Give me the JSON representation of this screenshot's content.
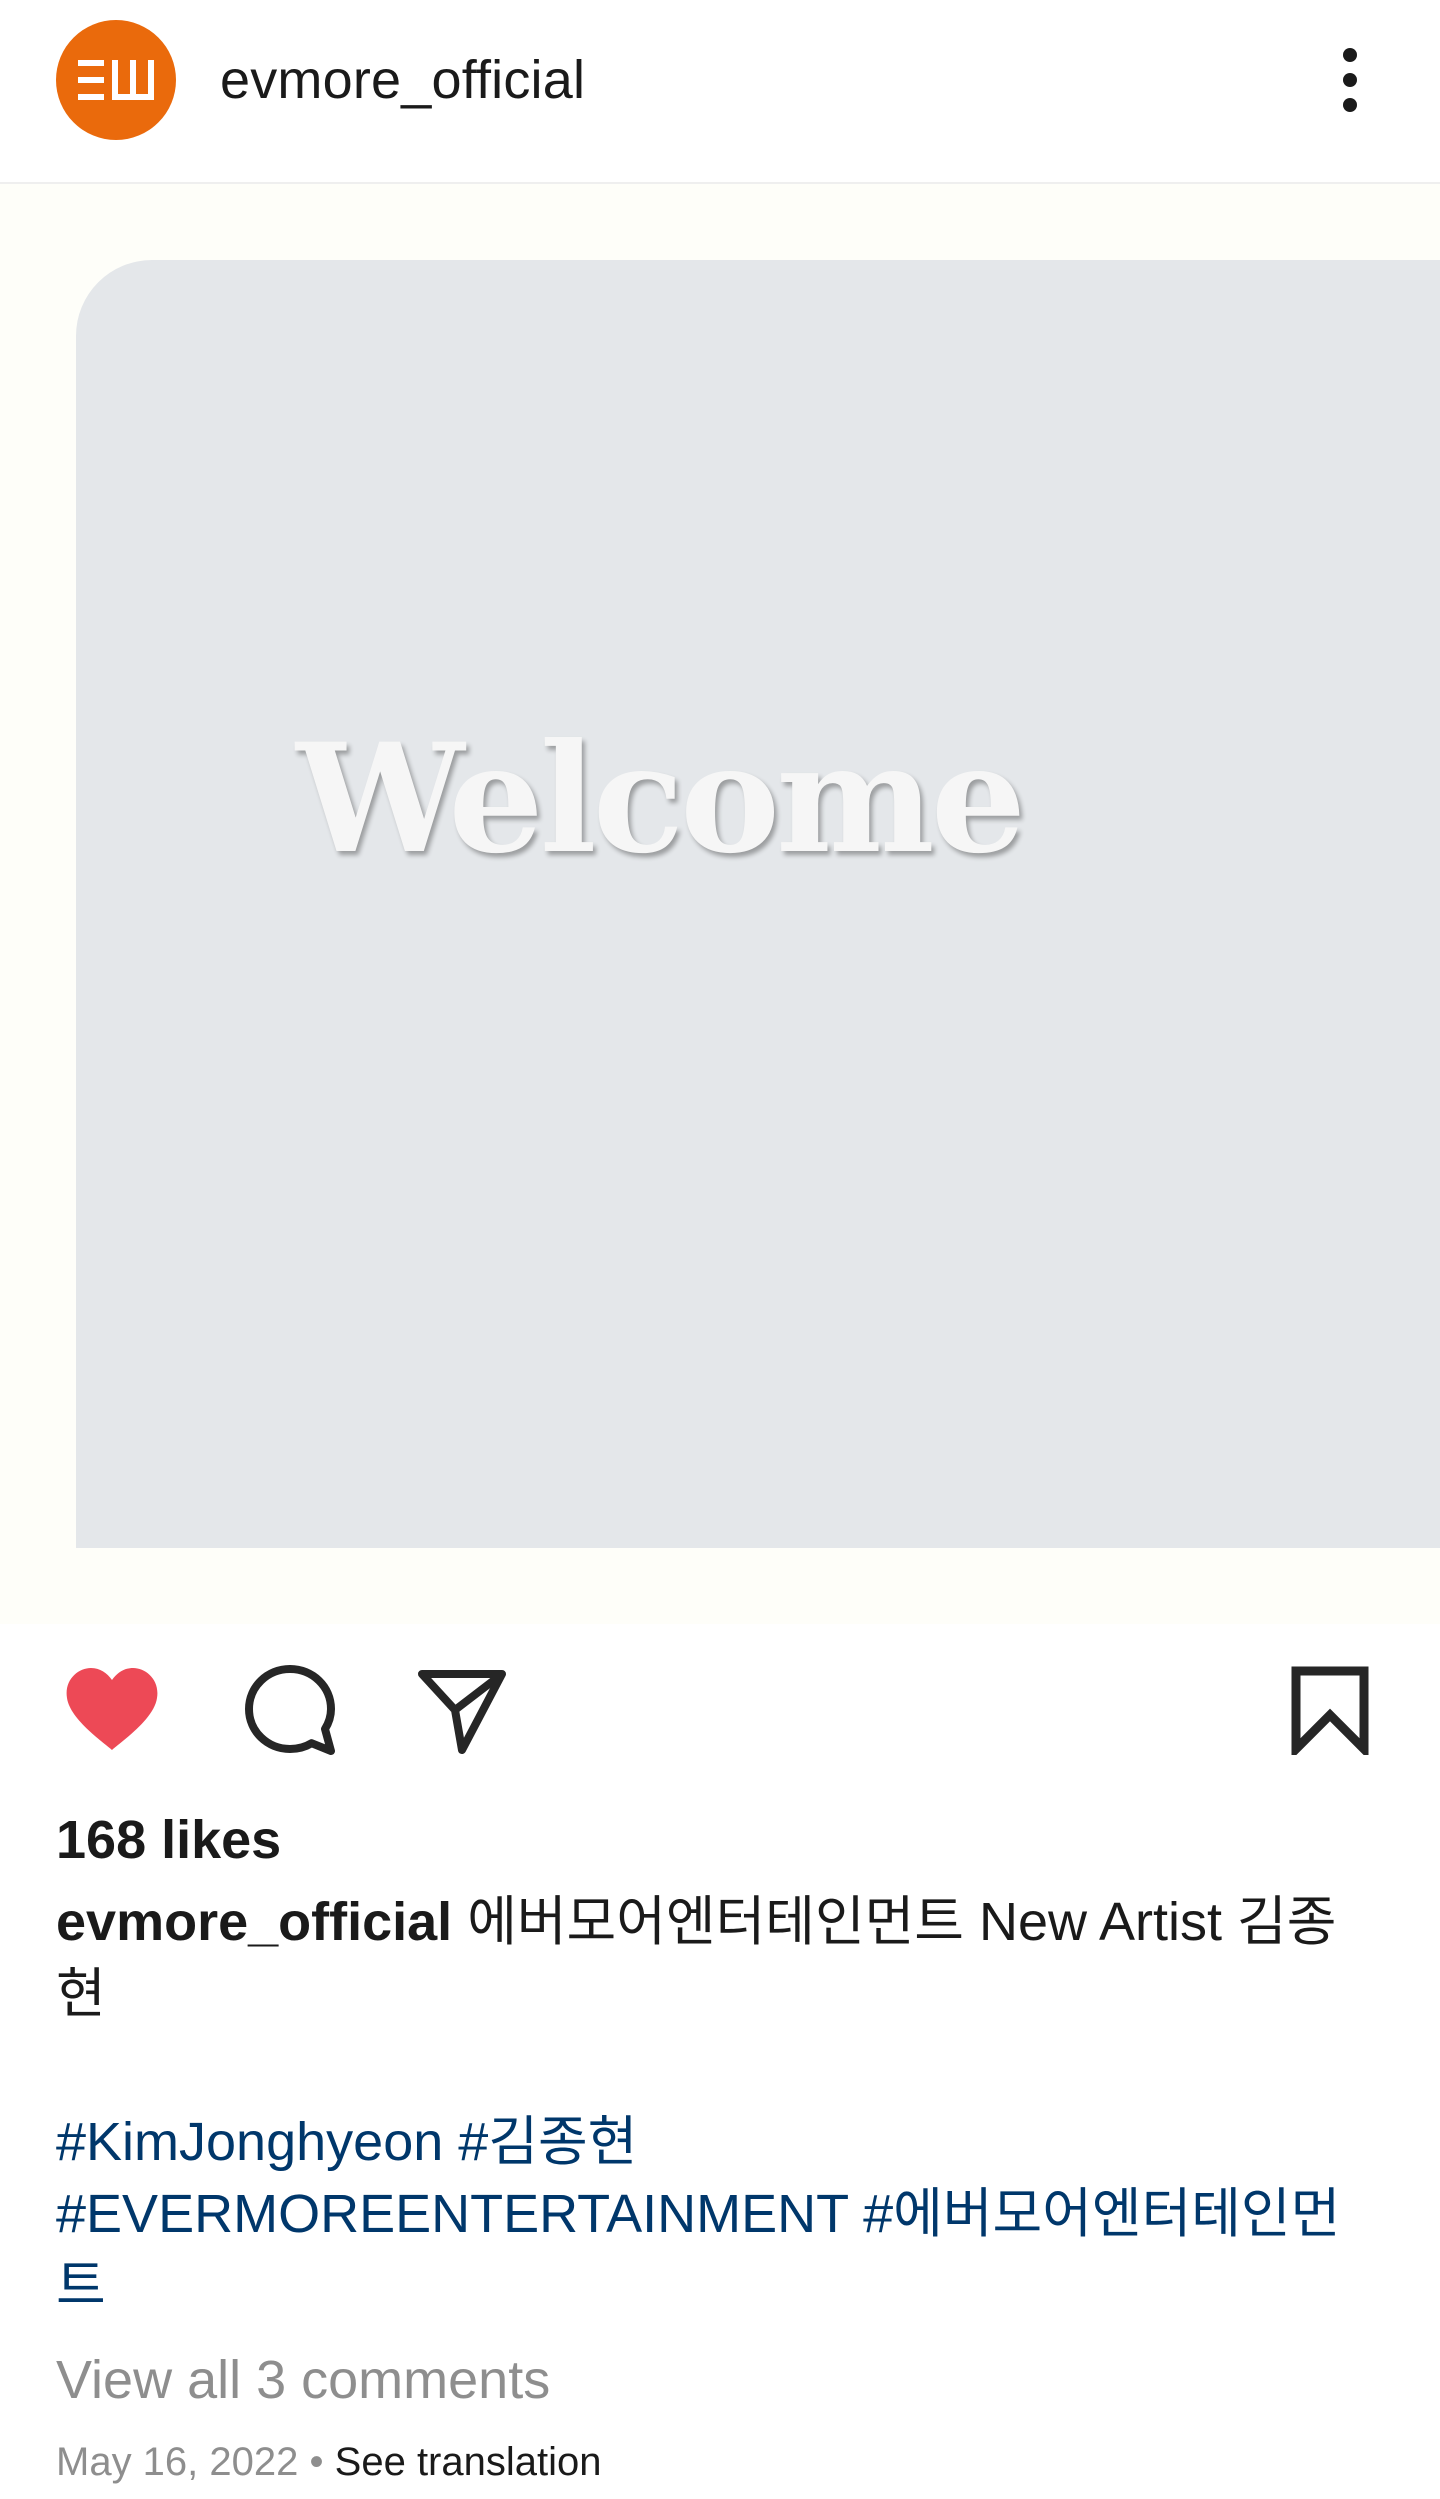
{
  "post": {
    "username": "evmore_official",
    "avatar_text": "EM",
    "avatar_color": "#ea6a0c",
    "more_icon": "more-vertical-icon",
    "image_text": "Welcome",
    "image_background": "#e4e7ea"
  },
  "actions": {
    "like_icon": "heart-icon",
    "like_color": "#ed4956",
    "liked": true,
    "comment_icon": "comment-icon",
    "share_icon": "send-icon",
    "save_icon": "bookmark-icon"
  },
  "likes_text": "168 likes",
  "caption": {
    "username": "evmore_official",
    "line1": "에버모어엔터테인먼트 New Artist 김종",
    "line2": "현"
  },
  "hashtags": {
    "tag1": "#KimJonghyeon",
    "tag2": "#김종현",
    "tag3": "#EVERMOREENTERTAINMENT",
    "tag4": "#에버모어엔터테인먼",
    "tag4_wrap": "트",
    "link_color": "#00376b"
  },
  "comments_link": "View all 3 comments",
  "date": "May 16, 2022",
  "separator": "•",
  "translate_link": "See translation"
}
